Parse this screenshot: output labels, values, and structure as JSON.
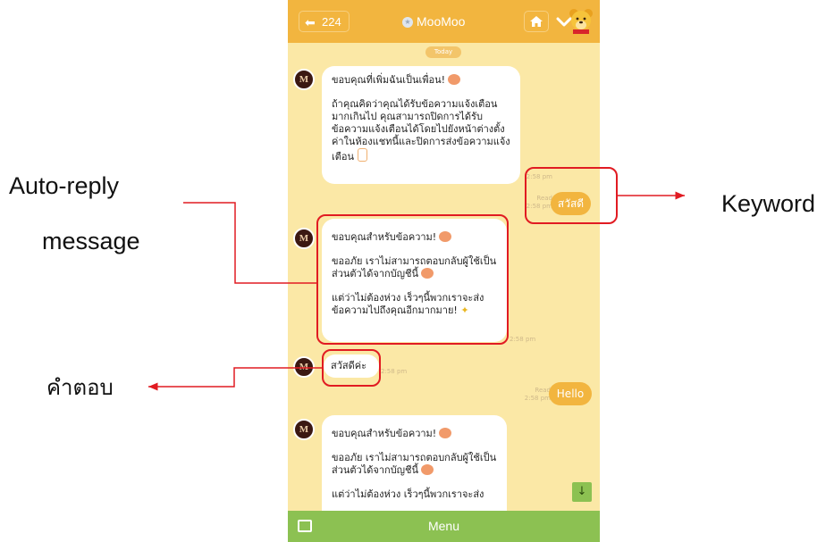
{
  "header": {
    "back_count": "224",
    "title": "MooMoo"
  },
  "today_label": "Today",
  "messages": {
    "welcome": {
      "line1": "ขอบคุณที่เพิ่มฉันเป็นเพื่อน!",
      "line2": "ถ้าคุณคิดว่าคุณได้รับข้อความแจ้งเตือนมากเกินไป คุณสามารถปิดการได้รับข้อความแจ้งเตือนได้โดยไปยังหน้าต่างตั้งค่าในห้องแชทนี้และปิดการส่งข้อความแจ้งเตือน"
    },
    "sent_1": {
      "text": "สวัสดี",
      "read": "Read",
      "time": "2:58 pm",
      "time_top": "2:58 pm"
    },
    "auto_reply_1": {
      "line1": "ขอบคุณสำหรับข้อความ!",
      "line2": "ขออภัย เราไม่สามารถตอบกลับผู้ใช้เป็นส่วนตัวได้จากบัญชีนี้",
      "line3": "แต่ว่าไม่ต้องห่วง เร็วๆนี้พวกเราจะส่งข้อความไปถึงคุณอีกมากมาย!",
      "time": "2:58 pm"
    },
    "reply_1": {
      "text": "สวัสดีค่ะ",
      "time": "2:58 pm"
    },
    "sent_2": {
      "text": "Hello",
      "read": "Read",
      "time": "2:58 pm"
    },
    "auto_reply_2": {
      "line1": "ขอบคุณสำหรับข้อความ!",
      "line2": "ขออภัย เราไม่สามารถตอบกลับผู้ใช้เป็นส่วนตัวได้จากบัญชีนี้",
      "line3": "แต่ว่าไม่ต้องห่วง เร็วๆนี้พวกเราจะส่ง"
    }
  },
  "bottom": {
    "menu_label": "Menu"
  },
  "annotations": {
    "auto_reply_line1": "Auto-reply",
    "auto_reply_line2": "message",
    "keyword": "Keyword",
    "answer": "คำตอบ"
  },
  "colors": {
    "topbar": "#f2b53f",
    "chat_bg": "#fbe8a6",
    "bottombar": "#8cc152",
    "highlight": "#e11b22"
  }
}
